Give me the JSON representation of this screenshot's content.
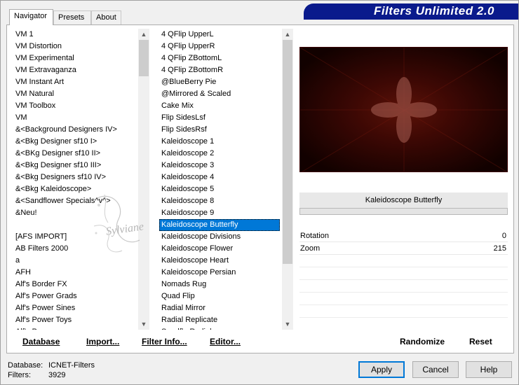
{
  "window": {
    "title": "Filters Unlimited 2.0"
  },
  "tabs": [
    {
      "label": "Navigator",
      "active": true
    },
    {
      "label": "Presets",
      "active": false
    },
    {
      "label": "About",
      "active": false
    }
  ],
  "categories": [
    "VM 1",
    "VM Distortion",
    "VM Experimental",
    "VM Extravaganza",
    "VM Instant Art",
    "VM Natural",
    "VM Toolbox",
    "VM",
    "&<Background Designers IV>",
    "&<Bkg Designer sf10 I>",
    "&<BKg Designer sf10 II>",
    "&<Bkg Designer sf10 III>",
    "&<Bkg Designers sf10 IV>",
    "&<Bkg Kaleidoscope>",
    "&<Sandflower Specials^v^>",
    "&Neu!",
    "",
    "[AFS IMPORT]",
    "AB Filters 2000",
    "a",
    "AFH",
    "Alf's Border FX",
    "Alf's Power Grads",
    "Alf's Power Sines",
    "Alf's Power Toys",
    "Alf's Power"
  ],
  "filters": [
    "4 QFlip UpperL",
    "4 QFlip UpperR",
    "4 QFlip ZBottomL",
    "4 QFlip ZBottomR",
    "@BlueBerry Pie",
    "@Mirrored & Scaled",
    "Cake Mix",
    "Flip SidesLsf",
    "Flip SidesRsf",
    "Kaleidoscope 1",
    "Kaleidoscope 2",
    "Kaleidoscope 3",
    "Kaleidoscope 4",
    "Kaleidoscope 5",
    "Kaleidoscope 8",
    "Kaleidoscope 9",
    "Kaleidoscope Butterfly",
    "Kaleidoscope Divisions",
    "Kaleidoscope Flower",
    "Kaleidoscope Heart",
    "Kaleidoscope Persian",
    "Nomads Rug",
    "Quad Flip",
    "Radial Mirror",
    "Radial Replicate",
    "Sandflo Radial"
  ],
  "selected_filter_index": 16,
  "preview": {
    "filter_name": "Kaleidoscope Butterfly"
  },
  "params": [
    {
      "label": "Rotation",
      "value": "0"
    },
    {
      "label": "Zoom",
      "value": "215"
    }
  ],
  "toolbar": {
    "database": "Database",
    "import": "Import...",
    "filter_info": "Filter Info...",
    "editor": "Editor...",
    "randomize": "Randomize",
    "reset": "Reset"
  },
  "buttons": {
    "apply": "Apply",
    "cancel": "Cancel",
    "help": "Help"
  },
  "status": {
    "database_label": "Database:",
    "database_value": "ICNET-Filters",
    "filters_label": "Filters:",
    "filters_value": "3929"
  },
  "watermark_text": "Sylviane",
  "colors": {
    "banner": "#0a1a8c",
    "selection": "#0078d7",
    "default_button_border": "#0078d7"
  }
}
